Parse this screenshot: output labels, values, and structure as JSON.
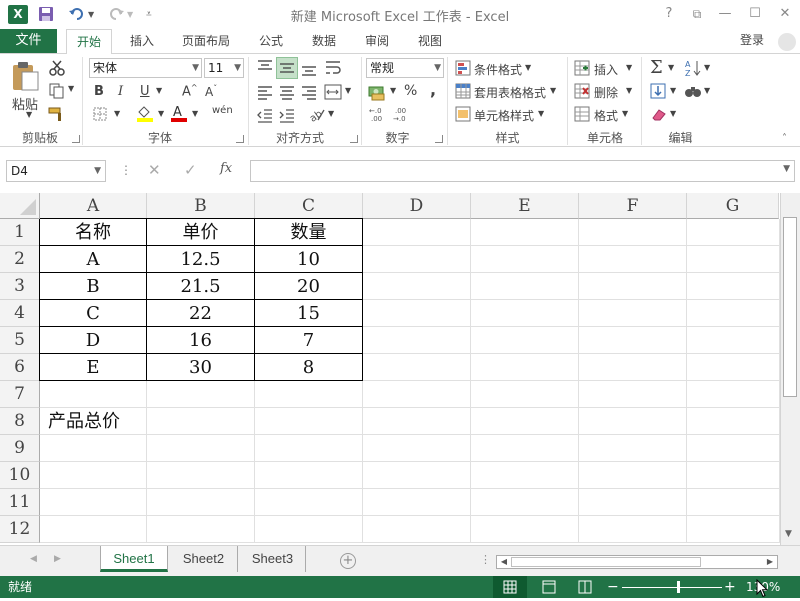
{
  "window": {
    "title": "新建 Microsoft Excel 工作表 - Excel",
    "app_icon": "X",
    "help": "?",
    "restore_ribbon": "⧉",
    "minimize": "—",
    "maximize": "☐",
    "close": "✕"
  },
  "tabs": {
    "file": "文件",
    "items": [
      "开始",
      "插入",
      "页面布局",
      "公式",
      "数据",
      "审阅",
      "视图"
    ],
    "active": "开始",
    "login": "登录"
  },
  "ribbon": {
    "clipboard": {
      "paste": "粘贴",
      "label": "剪贴板"
    },
    "font": {
      "name": "宋体",
      "size": "11",
      "bold": "B",
      "italic": "I",
      "underline": "U",
      "label": "字体",
      "grow": "A",
      "shrink": "A",
      "phonetic": "wén"
    },
    "align": {
      "label": "对齐方式"
    },
    "number": {
      "format": "常规",
      "percent": "%",
      "comma": ",",
      "label": "数字"
    },
    "styles": {
      "conditional": "条件格式",
      "table": "套用表格格式",
      "cell": "单元格样式",
      "label": "样式"
    },
    "cells": {
      "insert": "插入",
      "delete": "删除",
      "format": "格式",
      "label": "单元格"
    },
    "editing": {
      "label": "编辑"
    }
  },
  "formula_bar": {
    "name_box": "D4",
    "fx": "fx",
    "value": ""
  },
  "sheet": {
    "columns": [
      "A",
      "B",
      "C",
      "D",
      "E",
      "F",
      "G"
    ],
    "rows": [
      "1",
      "2",
      "3",
      "4",
      "5",
      "6",
      "7",
      "8",
      "9",
      "10",
      "11",
      "12"
    ],
    "cells": [
      [
        "名称",
        "单价",
        "数量"
      ],
      [
        "A",
        "12.5",
        "10"
      ],
      [
        "B",
        "21.5",
        "20"
      ],
      [
        "C",
        "22",
        "15"
      ],
      [
        "D",
        "16",
        "7"
      ],
      [
        "E",
        "30",
        "8"
      ],
      [
        "",
        "",
        ""
      ],
      [
        "产品总价",
        "",
        ""
      ]
    ]
  },
  "sheet_tabs": [
    "Sheet1",
    "Sheet2",
    "Sheet3"
  ],
  "active_sheet": "Sheet1",
  "status": {
    "ready": "就绪",
    "zoom": "130%"
  },
  "colors": {
    "accent": "#217346"
  }
}
